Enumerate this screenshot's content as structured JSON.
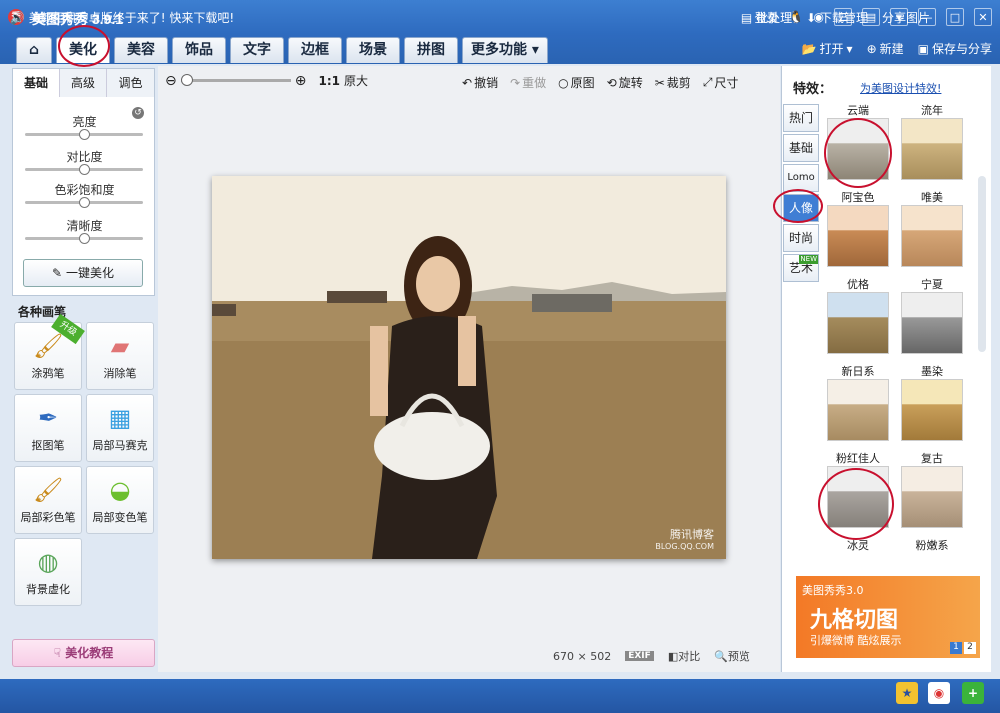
{
  "window": {
    "title": "美图秀秀 3.9.1",
    "login": "登录",
    "logo_text": "秀"
  },
  "tabs": [
    {
      "label": "美化"
    },
    {
      "label": "美容"
    },
    {
      "label": "饰品"
    },
    {
      "label": "文字"
    },
    {
      "label": "边框"
    },
    {
      "label": "场景"
    },
    {
      "label": "拼图"
    },
    {
      "label": "更多功能"
    }
  ],
  "toolbar": {
    "open": "打开",
    "new": "新建",
    "save": "保存与分享"
  },
  "adjust": {
    "tabs": [
      "基础",
      "高级",
      "调色"
    ],
    "sliders": [
      {
        "label": "亮度",
        "value": 0.5
      },
      {
        "label": "对比度",
        "value": 0.5
      },
      {
        "label": "色彩饱和度",
        "value": 0.5
      },
      {
        "label": "清晰度",
        "value": 0.5
      }
    ],
    "one_click": "一键美化"
  },
  "brushes": {
    "title": "各种画笔",
    "upgrade_badge": "升级",
    "items": [
      "涂鸦笔",
      "消除笔",
      "抠图笔",
      "局部马赛克",
      "局部彩色笔",
      "局部变色笔",
      "背景虚化"
    ]
  },
  "tutorial": "美化教程",
  "zoom": {
    "ratio": "1:1",
    "original_size": "原大"
  },
  "edit_tools": {
    "undo": "撤销",
    "redo": "重做",
    "original": "原图",
    "rotate": "旋转",
    "crop": "裁剪",
    "size": "尺寸"
  },
  "photo": {
    "width": "670",
    "height": "502",
    "times": "×",
    "exif": "EXIF",
    "compare": "对比",
    "preview": "预览",
    "watermark": "腾讯博客",
    "watermark_url": "BLOG.QQ.COM"
  },
  "effects": {
    "title": "特效：",
    "link": "为美图设计特效!",
    "categories": [
      "热门",
      "基础",
      "Lomo",
      "人像",
      "时尚",
      "艺术"
    ],
    "new_badge": "NEW",
    "items": [
      "云端",
      "流年",
      "阿宝色",
      "唯美",
      "优格",
      "宁夏",
      "新日系",
      "墨染",
      "粉红佳人",
      "复古",
      "冰灵",
      "粉嫩系"
    ]
  },
  "ad": {
    "brand": "美图秀秀3.0",
    "headline": "九格切图",
    "sub": "引爆微博 酷炫展示",
    "pages": [
      "1",
      "2"
    ]
  },
  "status": {
    "message": "美颜相机安卓版终于来了! 快来下载吧!",
    "batch": "批处理",
    "download": "下载管理",
    "share": "分享图片"
  },
  "colors": {
    "accent": "#2e6bbf",
    "highlight": "#c8102e"
  }
}
